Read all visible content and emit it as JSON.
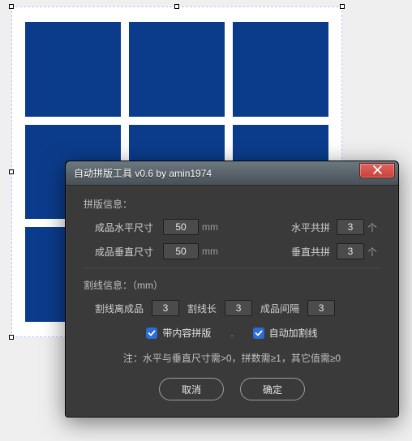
{
  "dialog": {
    "title": "自动拼版工具 v0.6   by amin1974",
    "section1_title": "拼版信息：",
    "width_label": "成品水平尺寸",
    "width_value": "50",
    "height_label": "成品垂直尺寸",
    "height_value": "50",
    "unit_mm": "mm",
    "unit_count": "个",
    "hcount_label": "水平共拼",
    "hcount_value": "3",
    "vcount_label": "垂直共拼",
    "vcount_value": "3",
    "section2_title": "割线信息：（mm）",
    "cut_gap_label": "割线离成品",
    "cut_gap_value": "3",
    "cut_len_label": "割线长",
    "cut_len_value": "3",
    "prod_gap_label": "成品间隔",
    "prod_gap_value": "3",
    "checkbox1_label": "带内容拼版",
    "checkbox2_label": "自动加割线",
    "separator": ".",
    "note": "注：水平与垂直尺寸需>0，拼数需≥1，其它值需≥0",
    "cancel_label": "取消",
    "ok_label": "确定"
  }
}
